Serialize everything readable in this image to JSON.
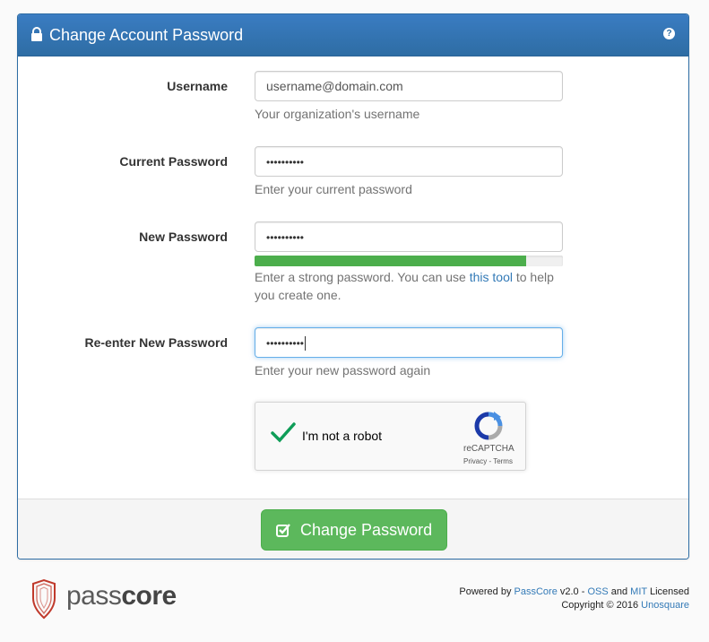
{
  "header": {
    "title": "Change Account Password",
    "help_icon": "?"
  },
  "form": {
    "username": {
      "label": "Username",
      "value": "username@domain.com",
      "help": "Your organization's username"
    },
    "current_password": {
      "label": "Current Password",
      "value": "••••••••••",
      "help": "Enter your current password"
    },
    "new_password": {
      "label": "New Password",
      "value": "••••••••••",
      "strength": 0.88,
      "help_before": "Enter a strong password. You can use ",
      "help_link": "this tool",
      "help_after": " to help you create one."
    },
    "confirm_password": {
      "label": "Re-enter New Password",
      "value": "••••••••••",
      "help": "Enter your new password again"
    }
  },
  "captcha": {
    "label": "I'm not a robot",
    "brand": "reCAPTCHA",
    "links": "Privacy - Terms"
  },
  "submit": {
    "label": "Change Password"
  },
  "footer": {
    "logo_text_light": "pass",
    "logo_text_bold": "core",
    "powered_by": "Powered by ",
    "product_link": "PassCore",
    "version": " v2.0 - ",
    "oss_link": "OSS",
    "and": " and ",
    "mit_link": "MIT",
    "licensed": " Licensed",
    "copyright": "Copyright © 2016 ",
    "company_link": "Unosquare"
  },
  "colors": {
    "header_blue": "#2e6da4",
    "success_green": "#5cb85c",
    "link_blue": "#337ab7"
  }
}
